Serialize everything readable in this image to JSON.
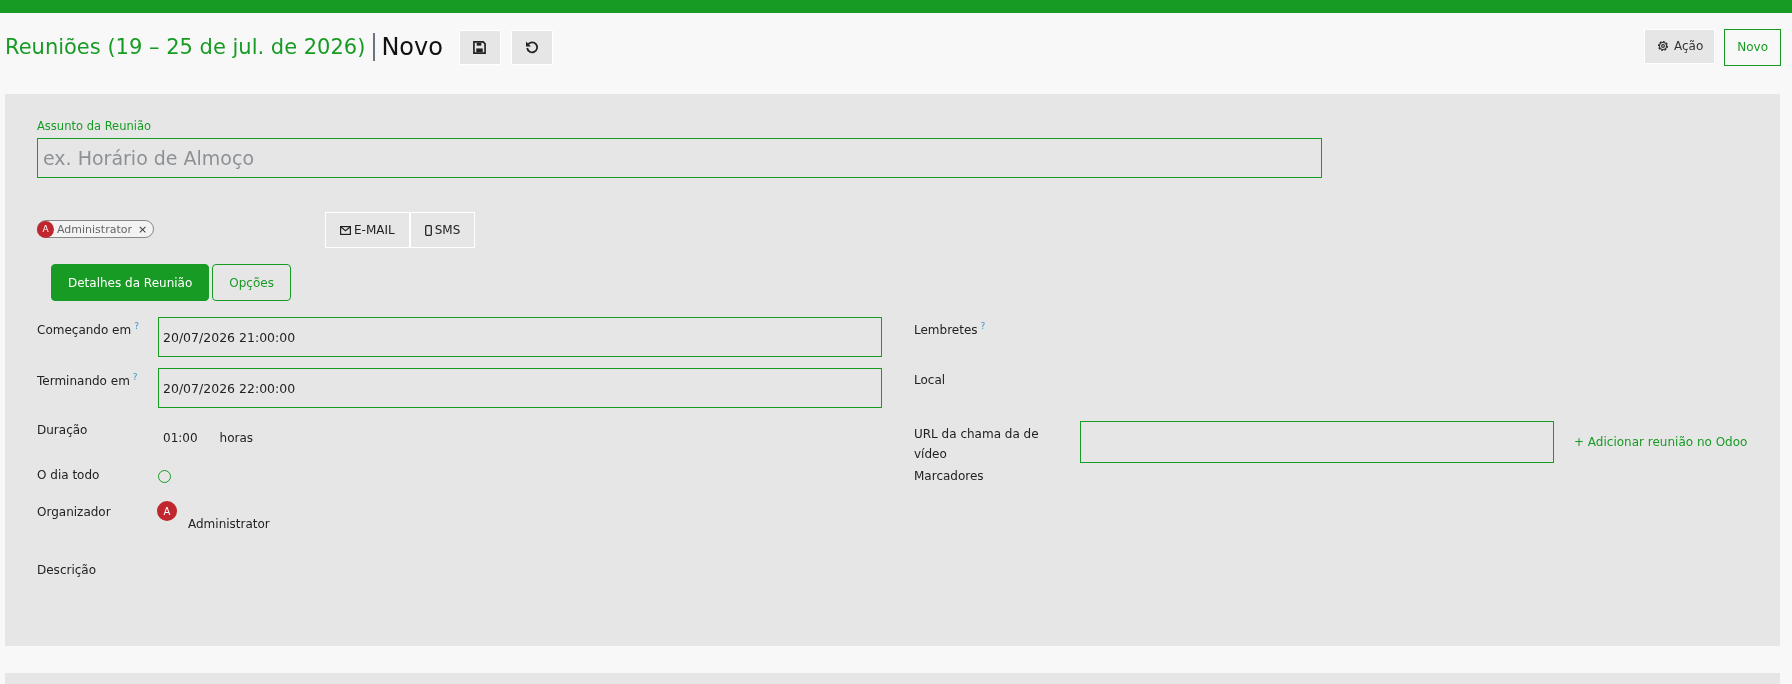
{
  "breadcrumb": {
    "parent": "Reuniões (19 – 25 de jul. de 2026)",
    "current": "Novo"
  },
  "header_actions": {
    "action_label": "Ação",
    "new_label": "Novo"
  },
  "subject": {
    "label": "Assunto da Reunião",
    "placeholder": "ex. Horário de Almoço"
  },
  "attendees": [
    {
      "initial": "A",
      "name": "Administrator",
      "remove": "×",
      "color": "#c0262d"
    }
  ],
  "send_buttons": [
    {
      "kind": "email",
      "label": "E-MAIL"
    },
    {
      "kind": "sms",
      "label": "SMS"
    }
  ],
  "tabs": [
    {
      "label": "Detalhes da Reunião",
      "selected": true
    },
    {
      "label": "Opções",
      "selected": false
    }
  ],
  "left_fields": [
    {
      "kind": "input",
      "label": "Começando em",
      "help": "?",
      "value": "20/07/2026 21:00:00"
    },
    {
      "kind": "input",
      "label": "Terminando em",
      "help": "?",
      "value": "20/07/2026 22:00:00"
    },
    {
      "kind": "duration",
      "label": "Duração",
      "value": "01:00",
      "unit": "horas"
    },
    {
      "kind": "checkbox",
      "label": "O dia todo",
      "checked": false
    },
    {
      "kind": "user",
      "label": "Organizador",
      "initial": "A",
      "value": "Administrator"
    },
    {
      "kind": "empty",
      "label": "Descrição"
    }
  ],
  "right_fields": [
    {
      "kind": "empty",
      "label": "Lembretes",
      "help": "?"
    },
    {
      "kind": "empty",
      "label": "Local"
    },
    {
      "kind": "url",
      "label": "URL da chama da de vídeo",
      "link": "+ Adicionar reunião no Odoo"
    },
    {
      "kind": "empty",
      "label": "Marcadores"
    }
  ]
}
